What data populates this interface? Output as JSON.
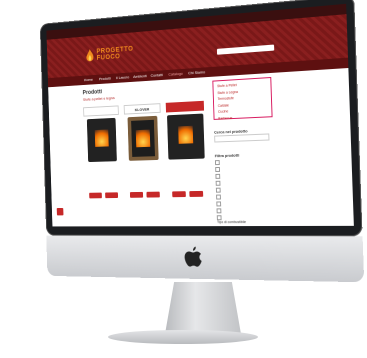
{
  "site": {
    "logo_line1": "PROGETTO",
    "logo_line2": "FUOCO",
    "nav": [
      "Home",
      "Prodotti",
      "Il Lavoro",
      "Ambienti",
      "Contatti",
      "Catalogo",
      "Chi Siamo"
    ]
  },
  "main": {
    "page_title": "Prodotti",
    "page_subtitle": "Stufe a pellet e legna",
    "products": [
      {
        "brand": "",
        "name": "",
        "description": ""
      },
      {
        "brand": "KLOVER",
        "name": "",
        "description": ""
      },
      {
        "brand": "",
        "name": "",
        "description": ""
      }
    ]
  },
  "sidebar": {
    "categories": [
      "Stufe a Pellet",
      "Stufe a Legna",
      "Termostufe",
      "Caldaie",
      "Cucine",
      "Barbecue"
    ],
    "search_label": "Cerca nel prodotto",
    "filters_label": "Filtra prodotti",
    "filters": [
      "",
      "",
      "",
      "",
      "",
      "",
      "",
      "",
      ""
    ],
    "type_label": "Tipo di combustibile"
  },
  "colors": {
    "brand_red": "#8a1f1f",
    "accent_orange": "#f08a1e",
    "highlight_pink": "#d81b60"
  }
}
